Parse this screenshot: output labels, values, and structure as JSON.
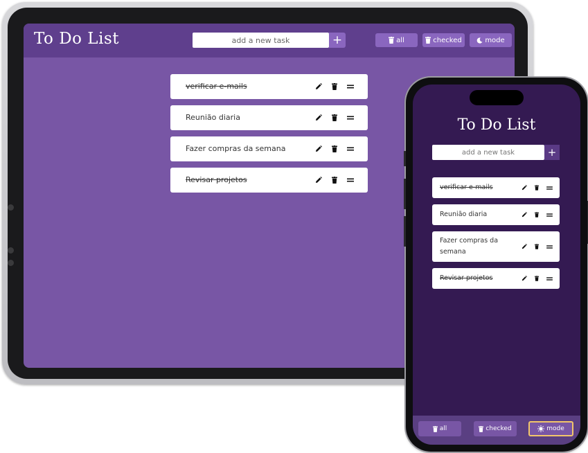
{
  "app": {
    "title": "To Do List"
  },
  "input": {
    "placeholder": "add a new task",
    "add_label": "+"
  },
  "controls": {
    "all_label": "all",
    "checked_label": "checked",
    "mode_label": "mode"
  },
  "tasks": [
    {
      "text": "verificar e-mails",
      "done": true
    },
    {
      "text": "Reunião diaria",
      "done": false
    },
    {
      "text": "Fazer compras da semana",
      "done": false
    },
    {
      "text": "Revisar projetos",
      "done": true
    }
  ],
  "colors": {
    "tablet_background": "#7856a5",
    "tablet_header": "#5f3f8d",
    "button": "#8a66bf",
    "phone_background": "#341a52",
    "phone_footer": "#5a3f82",
    "active_border": "#f2c66a"
  },
  "icons": {
    "delete": "trash-icon",
    "edit": "pencil-icon",
    "drag": "drag-handle-icon",
    "dark_mode": "moon-icon",
    "light_mode": "sun-icon"
  }
}
